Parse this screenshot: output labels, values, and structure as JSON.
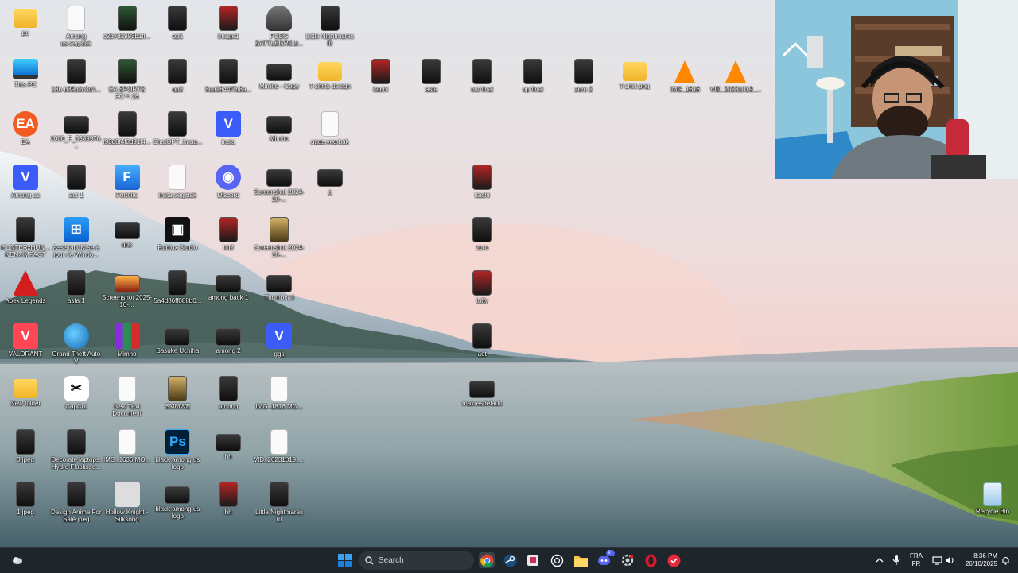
{
  "desktop_icons": [
    {
      "label": "pc",
      "kind": "folder",
      "col": 0,
      "row": 0
    },
    {
      "label": "Among us.veg.bak",
      "kind": "file",
      "col": 1,
      "row": 0
    },
    {
      "label": "c2b7d1993b1ff...",
      "kind": "img-green",
      "col": 2,
      "row": 0
    },
    {
      "label": "op1",
      "kind": "img",
      "col": 3,
      "row": 0
    },
    {
      "label": "Image1",
      "kind": "img-red",
      "col": 4,
      "row": 0
    },
    {
      "label": "PUBG BATTLEGROU...",
      "kind": "pubg",
      "col": 5,
      "row": 0
    },
    {
      "label": "Little Nightmares III",
      "kind": "img",
      "col": 6,
      "row": 0
    },
    {
      "label": "This PC",
      "kind": "pc",
      "col": 0,
      "row": 1
    },
    {
      "label": "13b-b39b2c3d4...",
      "kind": "img",
      "col": 1,
      "row": 1
    },
    {
      "label": "EA SPORTS FC™ 26",
      "kind": "img-green",
      "col": 2,
      "row": 1
    },
    {
      "label": "op2",
      "kind": "img",
      "col": 3,
      "row": 1
    },
    {
      "label": "5ad1844f7b8a...",
      "kind": "img",
      "col": 4,
      "row": 1
    },
    {
      "label": "Mimho - Copy",
      "kind": "wide",
      "col": 5,
      "row": 1
    },
    {
      "label": "T-shirts design",
      "kind": "folder",
      "col": 6,
      "row": 1
    },
    {
      "label": "itachi",
      "kind": "img-red",
      "col": 7,
      "row": 1
    },
    {
      "label": "asta",
      "kind": "img",
      "col": 8,
      "row": 1
    },
    {
      "label": "cut final",
      "kind": "img",
      "col": 9,
      "row": 1
    },
    {
      "label": "op final",
      "kind": "img",
      "col": 10,
      "row": 1
    },
    {
      "label": "zoro 2",
      "kind": "img",
      "col": 11,
      "row": 1
    },
    {
      "label": "T-shirt png",
      "kind": "folder",
      "col": 12,
      "row": 1
    },
    {
      "label": "IMG_1816",
      "kind": "vlc",
      "col": 13,
      "row": 1
    },
    {
      "label": "VID_20231019_...",
      "kind": "vlc",
      "col": 14,
      "row": 1
    },
    {
      "label": "EA",
      "kind": "ea",
      "col": 0,
      "row": 2
    },
    {
      "label": "1000_F_5389976...",
      "kind": "wide",
      "col": 1,
      "row": 2
    },
    {
      "label": "f93d8f4f3d91f4...",
      "kind": "img",
      "col": 2,
      "row": 2
    },
    {
      "label": "ChatGPT_Imag...",
      "kind": "img",
      "col": 3,
      "row": 2
    },
    {
      "label": "insta",
      "kind": "v",
      "col": 4,
      "row": 2
    },
    {
      "label": "Mimho",
      "kind": "wide",
      "col": 5,
      "row": 2
    },
    {
      "label": "gggs.veg.bak",
      "kind": "file",
      "col": 6,
      "row": 2
    },
    {
      "label": "Among us",
      "kind": "v",
      "col": 0,
      "row": 3
    },
    {
      "label": "aot 1",
      "kind": "img",
      "col": 1,
      "row": 3
    },
    {
      "label": "Fortnite",
      "kind": "fort",
      "col": 2,
      "row": 3
    },
    {
      "label": "insta.veg.bak",
      "kind": "file",
      "col": 3,
      "row": 3
    },
    {
      "label": "Discord",
      "kind": "discord",
      "col": 4,
      "row": 3
    },
    {
      "label": "Screenshot 2024-10-...",
      "kind": "wide",
      "col": 5,
      "row": 3
    },
    {
      "label": "g",
      "kind": "wide",
      "col": 6,
      "row": 3
    },
    {
      "label": "itachi",
      "kind": "img-red",
      "col": 9,
      "row": 3
    },
    {
      "label": "HUNTERxHUN... NEN×IMPACT",
      "kind": "img",
      "col": 0,
      "row": 4
    },
    {
      "label": "Assistant Mise à jour de Windo...",
      "kind": "win",
      "col": 1,
      "row": 4
    },
    {
      "label": "ggs",
      "kind": "wide",
      "col": 2,
      "row": 4
    },
    {
      "label": "Roblox Studio",
      "kind": "roblox",
      "col": 3,
      "row": 4
    },
    {
      "label": "hh2",
      "kind": "img-red",
      "col": 4,
      "row": 4
    },
    {
      "label": "Screenshot 2024-10-...",
      "kind": "img-sand",
      "col": 5,
      "row": 4
    },
    {
      "label": "zoro",
      "kind": "img",
      "col": 9,
      "row": 4
    },
    {
      "label": "Apex Legends",
      "kind": "apex",
      "col": 0,
      "row": 5
    },
    {
      "label": "asta 1",
      "kind": "img",
      "col": 1,
      "row": 5
    },
    {
      "label": "Screenshot 2025-10-...",
      "kind": "fire",
      "col": 2,
      "row": 5
    },
    {
      "label": "5a4d86ff088b0...",
      "kind": "img",
      "col": 3,
      "row": 5
    },
    {
      "label": "among back 1",
      "kind": "wide",
      "col": 4,
      "row": 5
    },
    {
      "label": "Thumbnail",
      "kind": "wide",
      "col": 5,
      "row": 5
    },
    {
      "label": "luffy",
      "kind": "img-red",
      "col": 9,
      "row": 5
    },
    {
      "label": "VALORANT",
      "kind": "valo",
      "col": 0,
      "row": 6
    },
    {
      "label": "Grand Theft Auto V",
      "kind": "gta",
      "col": 1,
      "row": 6
    },
    {
      "label": "Mimho",
      "kind": "rar",
      "col": 2,
      "row": 6
    },
    {
      "label": "Sasuke Uchiha",
      "kind": "wide",
      "col": 3,
      "row": 6
    },
    {
      "label": "among 2",
      "kind": "wide",
      "col": 4,
      "row": 6
    },
    {
      "label": "ggs",
      "kind": "v",
      "col": 5,
      "row": 6
    },
    {
      "label": "aot",
      "kind": "img",
      "col": 9,
      "row": 6
    },
    {
      "label": "New folder",
      "kind": "folder",
      "col": 0,
      "row": 7
    },
    {
      "label": "CapCut",
      "kind": "capcut",
      "col": 1,
      "row": 7
    },
    {
      "label": "New Text Document",
      "kind": "file",
      "col": 2,
      "row": 7
    },
    {
      "label": "SMMWE",
      "kind": "img-sand",
      "col": 3,
      "row": 7
    },
    {
      "label": "among",
      "kind": "img",
      "col": 4,
      "row": 7
    },
    {
      "label": "IMG_1816.MO...",
      "kind": "file",
      "col": 5,
      "row": 7
    },
    {
      "label": "maxresdefault",
      "kind": "wide",
      "col": 9,
      "row": 7
    },
    {
      "label": "0.jpeg",
      "kind": "img",
      "col": 0,
      "row": 8
    },
    {
      "label": "Decorate laptops, Hydro Flasks, c...",
      "kind": "img",
      "col": 1,
      "row": 8
    },
    {
      "label": "IMG_1636.MO...",
      "kind": "file",
      "col": 2,
      "row": 8
    },
    {
      "label": "black among us logo",
      "kind": "ps",
      "col": 3,
      "row": 8
    },
    {
      "label": "hh",
      "kind": "wide",
      "col": 4,
      "row": 8
    },
    {
      "label": "VID_20231019_...",
      "kind": "file",
      "col": 5,
      "row": 8
    },
    {
      "label": "1.jpeg",
      "kind": "img",
      "col": 0,
      "row": 9
    },
    {
      "label": "Design Anime For Sale.jpeg",
      "kind": "img",
      "col": 1,
      "row": 9
    },
    {
      "label": "Hollow Knight - Silksong",
      "kind": "hollow",
      "col": 2,
      "row": 9
    },
    {
      "label": "black among us logo",
      "kind": "wide",
      "col": 3,
      "row": 9
    },
    {
      "label": "hh",
      "kind": "img-red",
      "col": 4,
      "row": 9
    },
    {
      "label": "Little Nightmares III",
      "kind": "img",
      "col": 5,
      "row": 9
    }
  ],
  "recycle_bin": {
    "label": "Recycle Bin"
  },
  "taskbar": {
    "search_placeholder": "Search",
    "pinned": [
      "chrome-icon",
      "steam-icon",
      "media-app-icon",
      "chatgpt-icon",
      "file-explorer-icon",
      "discord-icon",
      "settings-icon",
      "opera-icon",
      "norton-icon"
    ],
    "discord_badge": "9+",
    "language_top": "FRA",
    "language_bottom": "FR",
    "time": "8:36 PM",
    "date": "26/10/2025"
  },
  "colors": {
    "taskbar": "#1f262b",
    "win_blue": "#1c8ee8"
  }
}
